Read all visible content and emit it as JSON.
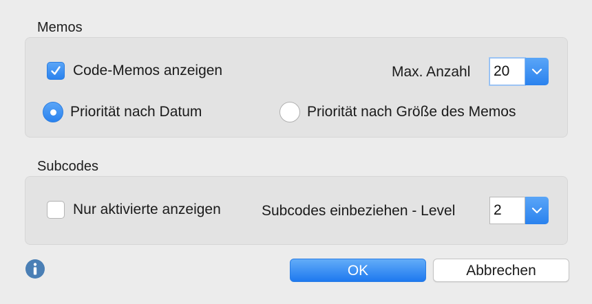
{
  "memos": {
    "title": "Memos",
    "show_code_memos": {
      "label": "Code-Memos anzeigen",
      "checked": true
    },
    "max_count": {
      "label": "Max. Anzahl",
      "value": "20"
    },
    "priority_date": {
      "label": "Priorität nach Datum",
      "selected": true
    },
    "priority_size": {
      "label": "Priorität nach Größe des Memos",
      "selected": false
    }
  },
  "subcodes": {
    "title": "Subcodes",
    "only_activated": {
      "label": "Nur aktivierte anzeigen",
      "checked": false
    },
    "include_level": {
      "label": "Subcodes einbeziehen - Level",
      "value": "2"
    }
  },
  "footer": {
    "info_icon": "info-circle-icon",
    "ok_label": "OK",
    "cancel_label": "Abbrechen"
  },
  "colors": {
    "accent": "#2a82ee",
    "background": "#ececec",
    "group_background": "#e3e3e3",
    "info_icon": "#4a7fb5"
  }
}
